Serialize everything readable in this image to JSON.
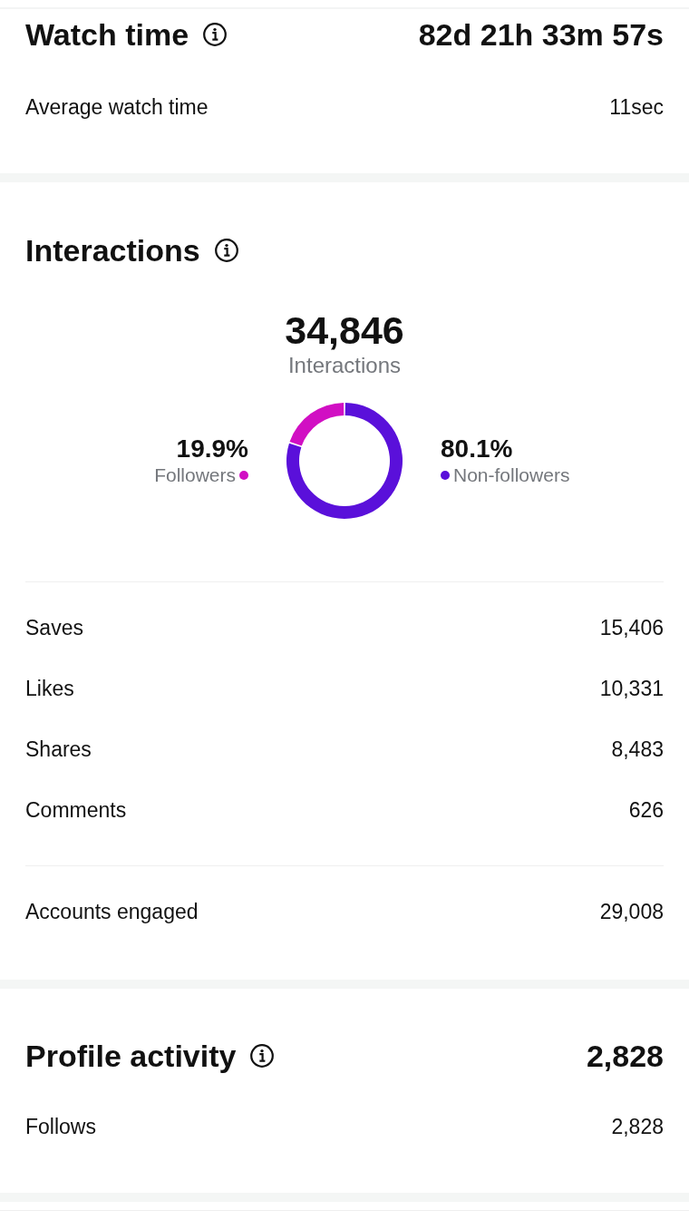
{
  "watch_time": {
    "title": "Watch time",
    "value": "82d 21h 33m 57s",
    "rows": [
      {
        "label": "Average watch time",
        "value": "11sec"
      }
    ]
  },
  "interactions": {
    "title": "Interactions",
    "total": "34,846",
    "total_label": "Interactions",
    "chart_data": {
      "type": "donut",
      "categories": [
        "Followers",
        "Non-followers"
      ],
      "values": [
        19.9,
        80.1
      ],
      "value_labels": [
        "19.9%",
        "80.1%"
      ],
      "colors": [
        "#d10fc3",
        "#5a10da"
      ]
    },
    "rows": [
      {
        "label": "Saves",
        "value": "15,406"
      },
      {
        "label": "Likes",
        "value": "10,331"
      },
      {
        "label": "Shares",
        "value": "8,483"
      },
      {
        "label": "Comments",
        "value": "626"
      }
    ],
    "summary_rows": [
      {
        "label": "Accounts engaged",
        "value": "29,008"
      }
    ]
  },
  "profile_activity": {
    "title": "Profile activity",
    "value": "2,828",
    "rows": [
      {
        "label": "Follows",
        "value": "2,828"
      }
    ]
  }
}
